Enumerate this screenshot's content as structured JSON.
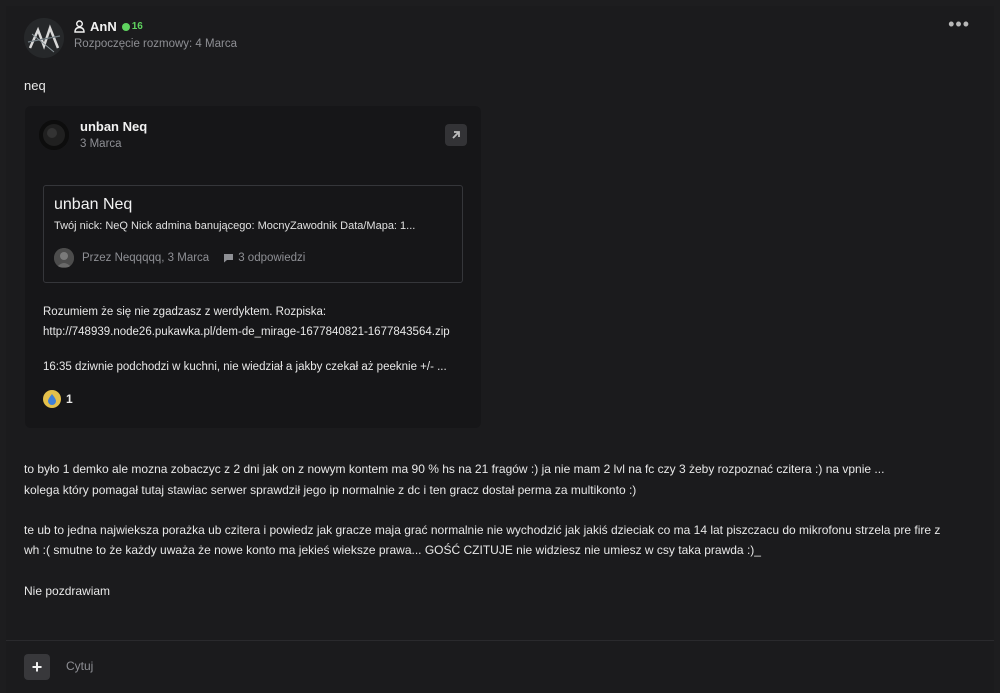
{
  "post": {
    "author": "AnN",
    "badge_count": "16",
    "started": "Rozpoczęcie rozmowy: 4 Marca",
    "lead": "neq",
    "avatar_text": "AN"
  },
  "embed": {
    "title": "unban Neq",
    "date": "3 Marca",
    "quote_title": "unban Neq",
    "quote_excerpt": "Twój nick: NeQ Nick admina banującego:  MocnyZawodnik Data/Mapa: 1...",
    "quote_author_line": "Przez Neqqqqq, 3 Marca",
    "replies": "3 odpowiedzi",
    "line1": "Rozumiem że się nie zgadzasz z werdyktem. Rozpiska:",
    "line2": "http://748939.node26.pukawka.pl/dem-de_mirage-1677840821-1677843564.zip",
    "line3": "16:35 dziwnie podchodzi w kuchni, nie wiedział a jakby czekał aż peeknie +/- ...",
    "reaction_count": "1"
  },
  "body": {
    "line1": "to było 1 demko ale mozna zobaczyc z 2 dni jak on z nowym kontem ma 90 % hs na 21 fragów :)  ja nie mam 2 lvl na fc czy 3 żeby rozpoznać czitera :) na vpnie ...",
    "line2": "kolega który pomagał tutaj stawiac serwer sprawdził jego ip normalnie z dc i ten gracz dostał perma za multikonto :)",
    "line3": "te ub to jedna najwieksza porażka ub czitera i powiedz jak gracze maja grać normalnie nie wychodzić jak jakiś dzieciak co ma 14 lat piszczacu do mikrofonu  strzela pre fire z",
    "line4": "wh :( smutne to że każdy uważa że nowe konto ma jekieś wieksze prawa... GOŚĆ CZITUJE  nie widziesz nie umiesz w csy taka prawda :)_",
    "line5": "Nie pozdrawiam"
  },
  "footer": {
    "plus": "+",
    "quote": "Cytuj"
  },
  "colors": {
    "background": "#1b1b1d",
    "accent_green": "#5fd35f",
    "muted": "#8e8f94"
  },
  "icons": [
    "user-icon",
    "badge-icon",
    "more-icon",
    "open-link-icon",
    "comment-icon",
    "reaction-icon",
    "plus-icon"
  ]
}
